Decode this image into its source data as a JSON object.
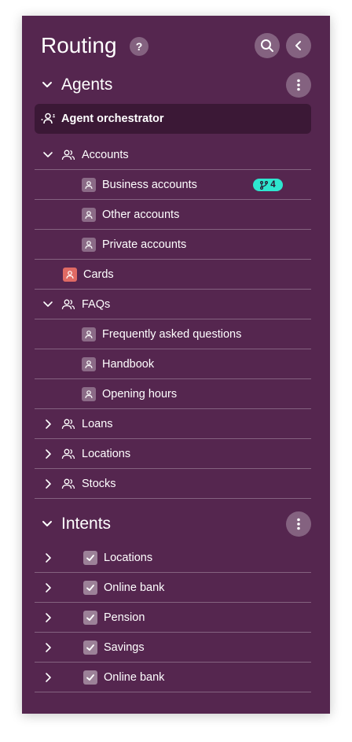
{
  "header": {
    "title": "Routing",
    "help_label": "?"
  },
  "agents_section": {
    "label": "Agents",
    "orchestrator": {
      "label": "Agent orchestrator"
    },
    "groups": [
      {
        "label": "Accounts",
        "expanded": true,
        "children": [
          {
            "label": "Business accounts",
            "badge": "4"
          },
          {
            "label": "Other accounts"
          },
          {
            "label": "Private accounts"
          }
        ]
      },
      {
        "label": "Cards",
        "type": "single-agent",
        "icon_color": "#e06a64"
      },
      {
        "label": "FAQs",
        "expanded": true,
        "children": [
          {
            "label": "Frequently asked questions"
          },
          {
            "label": "Handbook"
          },
          {
            "label": "Opening hours"
          }
        ]
      },
      {
        "label": "Loans",
        "expanded": false
      },
      {
        "label": "Locations",
        "expanded": false
      },
      {
        "label": "Stocks",
        "expanded": false
      }
    ]
  },
  "intents_section": {
    "label": "Intents",
    "items": [
      {
        "label": "Locations",
        "checked": true
      },
      {
        "label": "Online bank",
        "checked": true
      },
      {
        "label": "Pension",
        "checked": true
      },
      {
        "label": "Savings",
        "checked": true
      },
      {
        "label": "Online bank",
        "checked": true
      }
    ]
  },
  "colors": {
    "panel_bg": "#55264f",
    "orchestrator_bg": "#3b1836",
    "badge_bg": "#2ee6cf",
    "cards_icon": "#e06a64"
  }
}
